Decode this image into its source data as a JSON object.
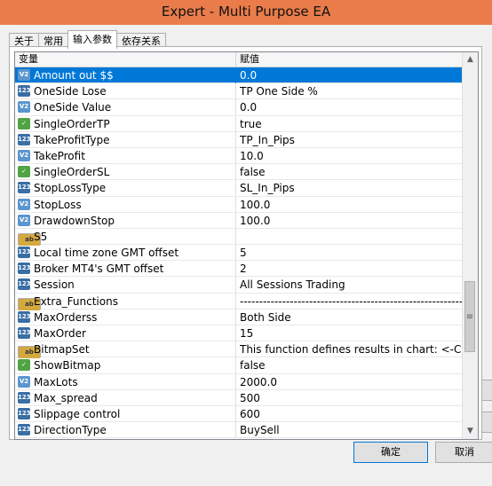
{
  "window": {
    "title": "Expert - Multi Purpose EA"
  },
  "tabs": [
    {
      "label": "关于",
      "active": false
    },
    {
      "label": "常用",
      "active": false
    },
    {
      "label": "输入参数",
      "active": true
    },
    {
      "label": "依存关系",
      "active": false
    }
  ],
  "grid": {
    "columns": {
      "name": "变量",
      "value": "赋值"
    },
    "rows": [
      {
        "icon": "v2-type-icon",
        "name": "Amount out $$",
        "value": "0.0",
        "selected": true
      },
      {
        "icon": "int-type-icon",
        "name": "OneSide Lose",
        "value": "TP One Side %"
      },
      {
        "icon": "v2-type-icon",
        "name": "OneSide Value",
        "value": "0.0"
      },
      {
        "icon": "bool-type-icon",
        "name": "SingleOrderTP",
        "value": "true"
      },
      {
        "icon": "int-type-icon",
        "name": "TakeProfitType",
        "value": "TP_In_Pips"
      },
      {
        "icon": "v2-type-icon",
        "name": "TakeProfit",
        "value": "10.0"
      },
      {
        "icon": "bool-type-icon",
        "name": "SingleOrderSL",
        "value": "false"
      },
      {
        "icon": "int-type-icon",
        "name": "StopLossType",
        "value": "SL_In_Pips"
      },
      {
        "icon": "v2-type-icon",
        "name": "StopLoss",
        "value": "100.0"
      },
      {
        "icon": "v2-type-icon",
        "name": "DrawdownStop",
        "value": "100.0"
      },
      {
        "icon": "string-type-icon",
        "name": "S5",
        "value": ""
      },
      {
        "icon": "int-type-icon",
        "name": "Local time zone GMT offset",
        "value": "5"
      },
      {
        "icon": "int-type-icon",
        "name": "Broker MT4's GMT offset",
        "value": "2"
      },
      {
        "icon": "int-type-icon",
        "name": "Session",
        "value": "All Sessions Trading"
      },
      {
        "icon": "string-type-icon",
        "name": "Extra_Functions",
        "value": "------------------------------------------------------------------------"
      },
      {
        "icon": "int-type-icon",
        "name": "MaxOrderss",
        "value": "Both Side"
      },
      {
        "icon": "int-type-icon",
        "name": "MaxOrder",
        "value": "15"
      },
      {
        "icon": "string-type-icon",
        "name": "BitmapSet",
        "value": "This function defines results in chart: <-Curre..."
      },
      {
        "icon": "bool-type-icon",
        "name": "ShowBitmap",
        "value": "false"
      },
      {
        "icon": "v2-type-icon",
        "name": "MaxLots",
        "value": "2000.0"
      },
      {
        "icon": "int-type-icon",
        "name": "Max_spread",
        "value": "500"
      },
      {
        "icon": "int-type-icon",
        "name": "Slippage control",
        "value": "600"
      },
      {
        "icon": "int-type-icon",
        "name": "DirectionType",
        "value": "BuySell"
      }
    ]
  },
  "buttons": {
    "ok": "确定",
    "cancel": "取消"
  },
  "colors": {
    "titlebar": "#e97c4a",
    "selection": "#0078d7"
  }
}
